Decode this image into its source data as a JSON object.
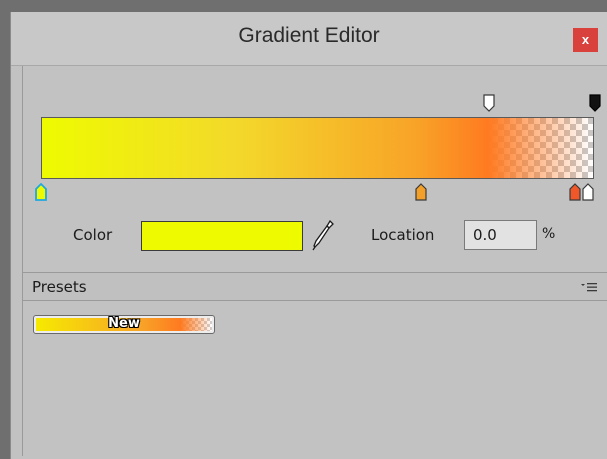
{
  "window": {
    "title": "Gradient Editor",
    "close_label": "x"
  },
  "gradient": {
    "colors": [
      "#eefb00",
      "#f3d92a",
      "#f8a328",
      "#ff7a20"
    ],
    "alpha_keys": [
      {
        "name": "alpha-key-white",
        "color": "#ffffff"
      },
      {
        "name": "alpha-key-black",
        "color": "#111111"
      }
    ],
    "color_keys": [
      {
        "name": "color-key-cyan-outline",
        "color": "#eefb00",
        "outline": "#1fa8e0"
      },
      {
        "name": "color-key-orange",
        "color": "#f3a02a"
      },
      {
        "name": "color-key-red",
        "color": "#f0582a"
      },
      {
        "name": "color-key-white",
        "color": "#ffffff"
      }
    ]
  },
  "editor": {
    "color_label": "Color",
    "color_value": "#eefb00",
    "location_label": "Location",
    "location_value": "0.0",
    "percent_label": "%"
  },
  "presets": {
    "title": "Presets",
    "items": [
      {
        "label": "New"
      }
    ]
  }
}
